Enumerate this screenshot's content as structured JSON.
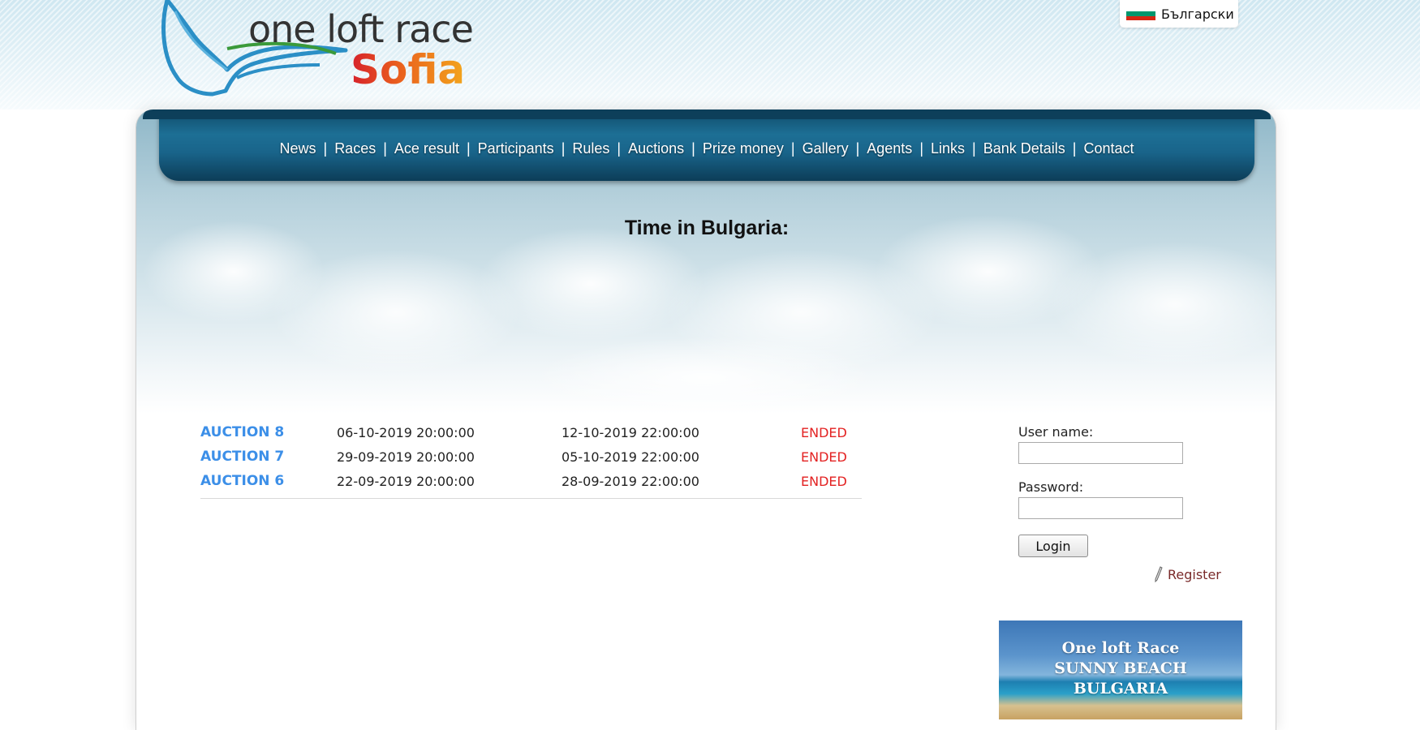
{
  "header": {
    "logo_line1": "one loft race",
    "logo_line2": "Sofia",
    "language": "Български"
  },
  "nav": {
    "items": [
      "News",
      "Races",
      "Ace result",
      "Participants",
      "Rules",
      "Auctions",
      "Prize money",
      "Gallery",
      "Agents",
      "Links",
      "Bank Details",
      "Contact"
    ],
    "separator": "|"
  },
  "main": {
    "time_title": "Time in Bulgaria:"
  },
  "auctions": [
    {
      "name": "AUCTION 8",
      "start": "06-10-2019 20:00:00",
      "end": "12-10-2019 22:00:00",
      "status": "ENDED"
    },
    {
      "name": "AUCTION 7",
      "start": "29-09-2019 20:00:00",
      "end": "05-10-2019 22:00:00",
      "status": "ENDED"
    },
    {
      "name": "AUCTION 6",
      "start": "22-09-2019 20:00:00",
      "end": "28-09-2019 22:00:00",
      "status": "ENDED"
    }
  ],
  "login": {
    "username_label": "User name:",
    "password_label": "Password:",
    "button_label": "Login",
    "register_label": "Register"
  },
  "promo": {
    "line1": "One loft Race",
    "line2": "SUNNY BEACH",
    "line3": "BULGARIA"
  },
  "colors": {
    "nav_blue": "#1d6f95",
    "auction_link": "#3c8fe8",
    "status_ended": "#e32222"
  }
}
